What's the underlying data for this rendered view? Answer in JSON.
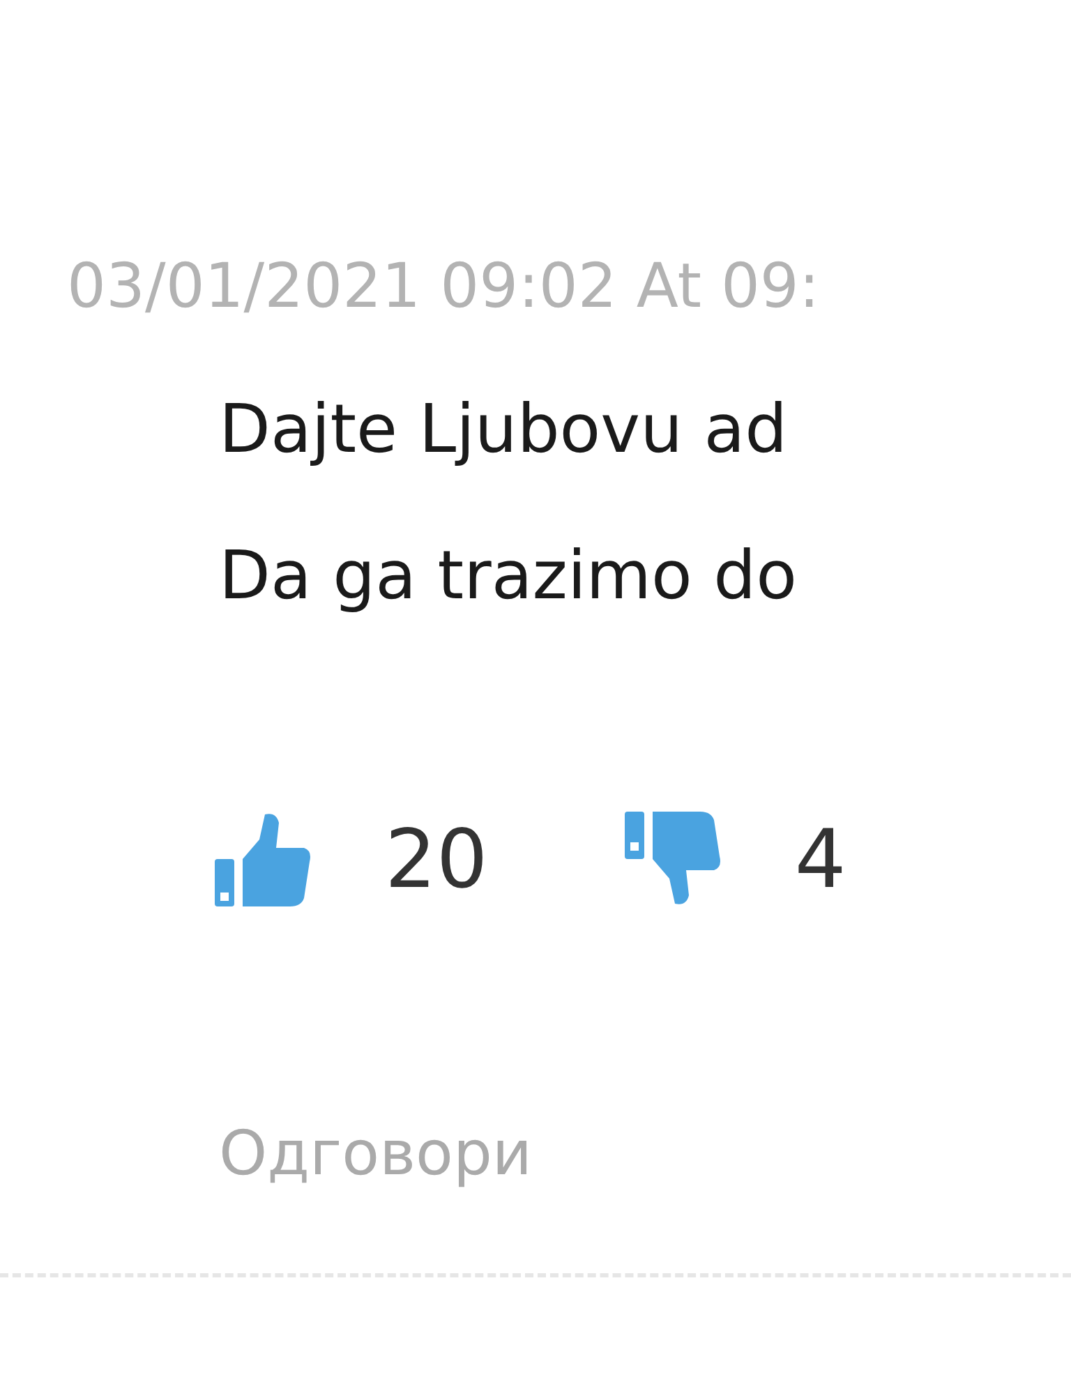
{
  "comment": {
    "timestamp": "03/01/2021 09:02 At 09:",
    "lines": [
      "Dajte Ljubovu ad",
      "Da ga trazimo do"
    ],
    "likes": "20",
    "dislikes": "4",
    "reply": "Одговори"
  }
}
